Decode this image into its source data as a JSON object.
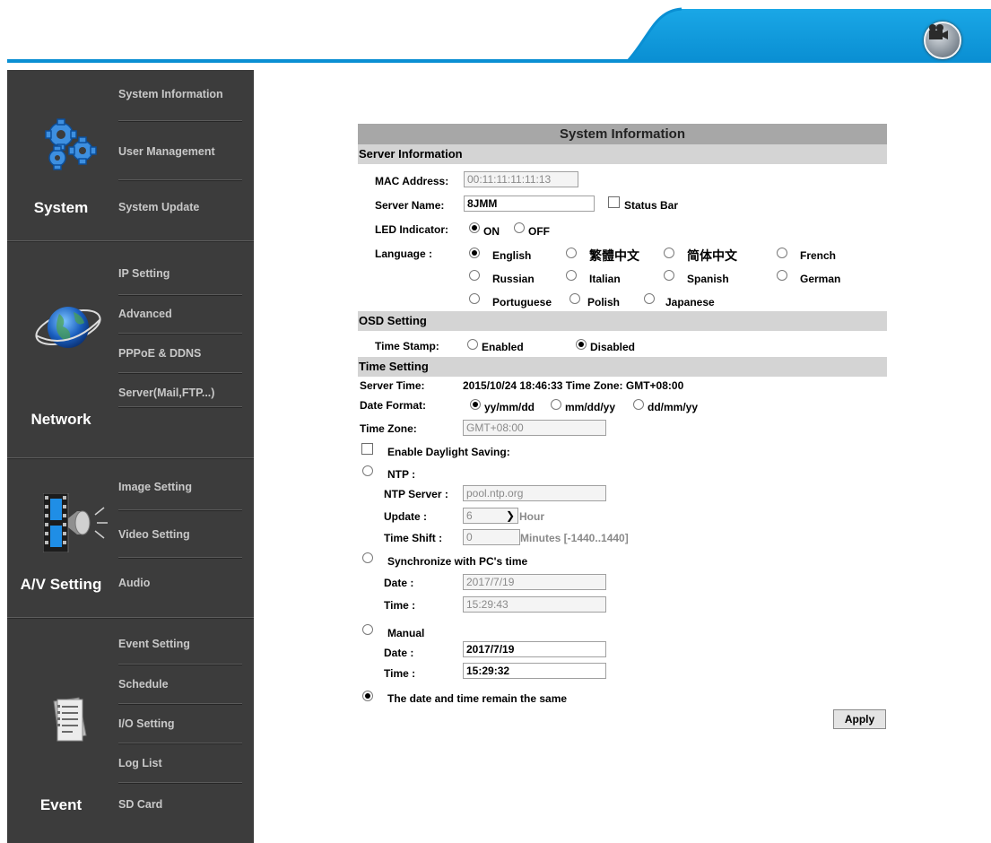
{
  "sidebar": {
    "sections": [
      {
        "title": "System",
        "icon": "gears-icon",
        "items": [
          "System Information",
          "User Management",
          "System Update"
        ]
      },
      {
        "title": "Network",
        "icon": "globe-icon",
        "items": [
          "IP Setting",
          "Advanced",
          "PPPoE & DDNS",
          "Server(Mail,FTP...)"
        ]
      },
      {
        "title": "A/V Setting",
        "icon": "film-speaker-icon",
        "items": [
          "Image Setting",
          "Video Setting",
          "Audio"
        ]
      },
      {
        "title": "Event",
        "icon": "document-icon",
        "items": [
          "Event Setting",
          "Schedule",
          "I/O Setting",
          "Log List",
          "SD Card"
        ]
      }
    ]
  },
  "header": {
    "button_icon": "video-camera-icon"
  },
  "panel": {
    "title": "System Information",
    "server": {
      "heading": "Server Information",
      "mac_label": "MAC Address:",
      "mac_value": "00:11:11:11:11:13",
      "name_label": "Server Name:",
      "name_value": "8JMM",
      "status_bar_label": "Status Bar",
      "led_label": "LED Indicator:",
      "led_on": "ON",
      "led_off": "OFF",
      "lang_label": "Language :",
      "languages": [
        "English",
        "繁體中文",
        "简体中文",
        "French",
        "Russian",
        "Italian",
        "Spanish",
        "German",
        "Portuguese",
        "Polish",
        "Japanese"
      ]
    },
    "osd": {
      "heading": "OSD Setting",
      "timestamp_label": "Time Stamp:",
      "enabled": "Enabled",
      "disabled": "Disabled"
    },
    "time": {
      "heading": "Time Setting",
      "server_time_label": "Server Time:",
      "server_time_value": "2015/10/24 18:46:33 Time Zone: GMT+08:00",
      "date_format_label": "Date Format:",
      "formats": [
        "yy/mm/dd",
        "mm/dd/yy",
        "dd/mm/yy"
      ],
      "timezone_label": "Time Zone:",
      "timezone_value": "GMT+08:00",
      "daylight_label": "Enable Daylight Saving:",
      "ntp_label": "NTP :",
      "ntp_server_label": "NTP Server :",
      "ntp_server_value": "pool.ntp.org",
      "update_label": "Update :",
      "update_value": "6",
      "update_unit": "Hour",
      "shift_label": "Time Shift :",
      "shift_value": "0",
      "shift_unit": "Minutes  [-1440..1440]",
      "sync_label": "Synchronize with PC's time",
      "sync_date_label": "Date :",
      "sync_date_value": "2017/7/19",
      "sync_time_label": "Time :",
      "sync_time_value": "15:29:43",
      "manual_label": "Manual",
      "manual_date_label": "Date :",
      "manual_date_value": "2017/7/19",
      "manual_time_label": "Time :",
      "manual_time_value": "15:29:32",
      "same_label": "The date and time remain the same"
    },
    "apply_label": "Apply"
  }
}
